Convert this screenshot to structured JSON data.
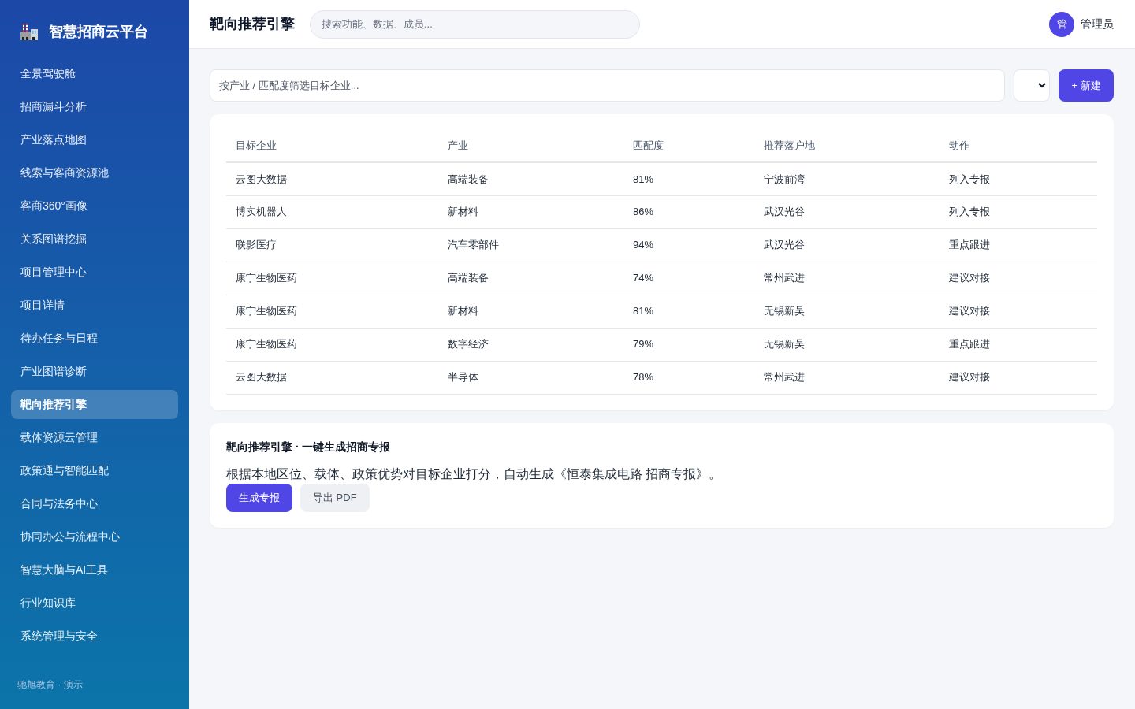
{
  "sidebar": {
    "logo_text": "智慧招商云平台",
    "items": [
      {
        "label": "全景驾驶舱",
        "selected": false
      },
      {
        "label": "招商漏斗分析",
        "selected": false
      },
      {
        "label": "产业落点地图",
        "selected": false
      },
      {
        "label": "线索与客商资源池",
        "selected": false
      },
      {
        "label": "客商360°画像",
        "selected": false
      },
      {
        "label": "关系图谱挖掘",
        "selected": false
      },
      {
        "label": "项目管理中心",
        "selected": false
      },
      {
        "label": "项目详情",
        "selected": false
      },
      {
        "label": "待办任务与日程",
        "selected": false
      },
      {
        "label": "产业图谱诊断",
        "selected": false
      },
      {
        "label": "靶向推荐引擎",
        "selected": true
      },
      {
        "label": "载体资源云管理",
        "selected": false
      },
      {
        "label": "政策通与智能匹配",
        "selected": false
      },
      {
        "label": "合同与法务中心",
        "selected": false
      },
      {
        "label": "协同办公与流程中心",
        "selected": false
      },
      {
        "label": "智慧大脑与AI工具",
        "selected": false
      },
      {
        "label": "行业知识库",
        "selected": false
      },
      {
        "label": "系统管理与安全",
        "selected": false
      }
    ],
    "footer": "驰旭教育 · 演示"
  },
  "header": {
    "title": "靶向推荐引擎",
    "search": {
      "placeholder": "搜索功能、数据、成员..."
    },
    "user": {
      "avatar": "管",
      "name": "管理员"
    }
  },
  "toolbar": {
    "filter": {
      "placeholder": "按产业 / 匹配度筛选目标企业..."
    },
    "new_button": "+ 新建"
  },
  "table": {
    "columns": [
      "目标企业",
      "产业",
      "匹配度",
      "推荐落户地",
      "动作"
    ],
    "rows": [
      [
        "云图大数据",
        "高端装备",
        "81%",
        "宁波前湾",
        "列入专报"
      ],
      [
        "博实机器人",
        "新材料",
        "86%",
        "武汉光谷",
        "列入专报"
      ],
      [
        "联影医疗",
        "汽车零部件",
        "94%",
        "武汉光谷",
        "重点跟进"
      ],
      [
        "康宁生物医药",
        "高端装备",
        "74%",
        "常州武进",
        "建议对接"
      ],
      [
        "康宁生物医药",
        "新材料",
        "81%",
        "无锡新吴",
        "建议对接"
      ],
      [
        "康宁生物医药",
        "数字经济",
        "79%",
        "无锡新吴",
        "重点跟进"
      ],
      [
        "云图大数据",
        "半导体",
        "78%",
        "常州武进",
        "建议对接"
      ]
    ]
  },
  "report_card": {
    "title": "靶向推荐引擎 · 一键生成招商专报",
    "text": "根据本地区位、载体、政策优势对目标企业打分，自动生成《恒泰集成电路 招商专报》。",
    "buttons": [
      {
        "label": "生成专报",
        "kind": "primary"
      },
      {
        "label": "导出 PDF",
        "kind": "secondary"
      }
    ]
  }
}
